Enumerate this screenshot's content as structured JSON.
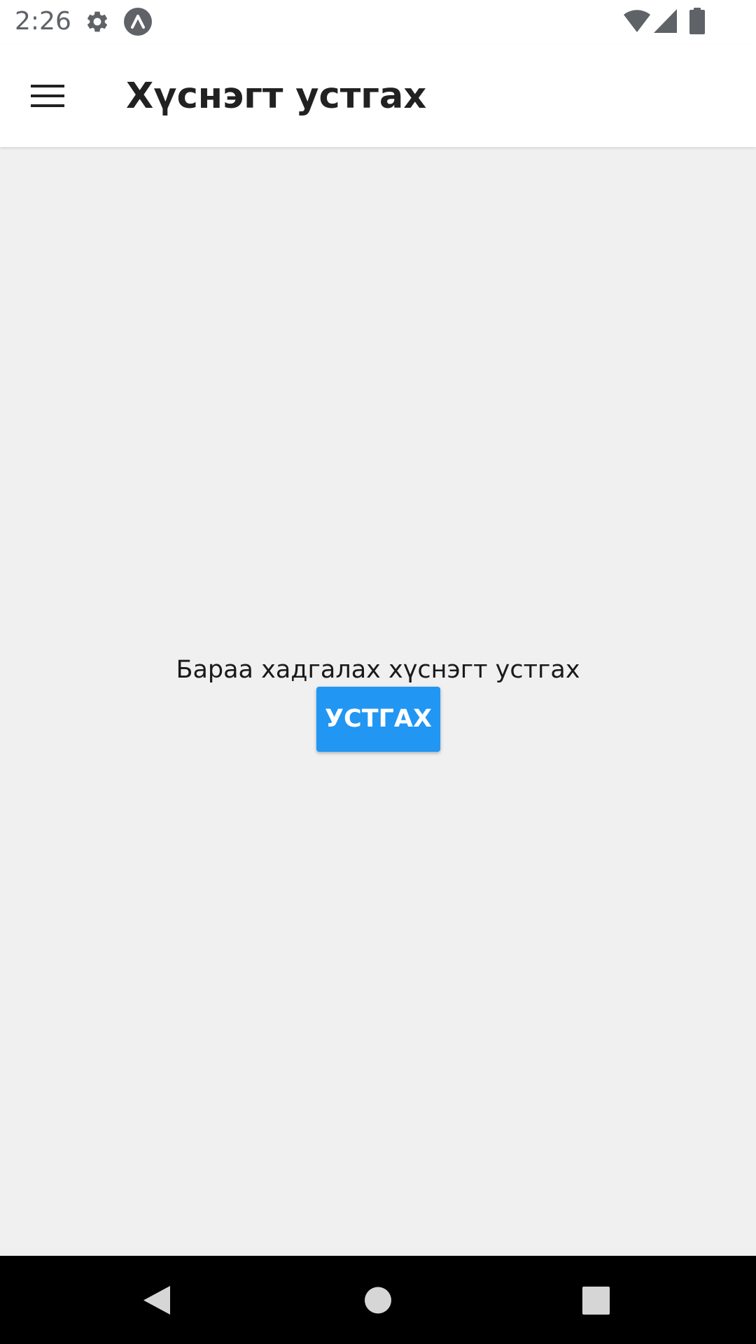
{
  "status_bar": {
    "time": "2:26",
    "icons": [
      "settings-icon",
      "app-notification-icon",
      "wifi-icon",
      "signal-icon",
      "battery-icon"
    ]
  },
  "app_bar": {
    "title": "Хүснэгт устгах",
    "menu_icon": "hamburger-menu-icon"
  },
  "content": {
    "message": "Бараа хадгалах хүснэгт устгах",
    "delete_button_label": "УСТГАХ"
  },
  "nav_bar": {
    "icons": [
      "back-icon",
      "home-icon",
      "recent-apps-icon"
    ]
  },
  "colors": {
    "primary_button": "#2196f3",
    "content_background": "#f0f0f0",
    "app_bar_background": "#ffffff",
    "nav_bar_background": "#000000",
    "title_text": "#212121"
  }
}
